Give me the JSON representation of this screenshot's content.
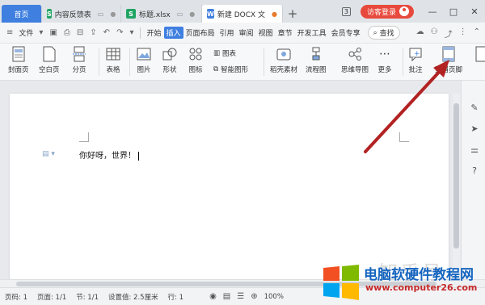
{
  "titlebar": {
    "home_tab": "首页",
    "tabs": [
      {
        "icon_letter": "S",
        "label": "内容反馈表"
      },
      {
        "icon_letter": "S",
        "label": "标题.xlsx"
      },
      {
        "icon_letter": "W",
        "label": "新建 DOCX 文"
      }
    ],
    "plus": "+",
    "badge": "3",
    "login_label": "访客登录",
    "window_buttons": [
      "—",
      "□",
      "✕"
    ]
  },
  "menu": {
    "file_label": "文件",
    "items": [
      "开始",
      "插入",
      "页面布局",
      "引用",
      "审阅",
      "视图",
      "章节",
      "开发工具",
      "会员专享"
    ],
    "active_item": "插入",
    "search_label": "查找"
  },
  "ribbon": {
    "cover_page": "封面页",
    "blank_page": "空白页",
    "page_break": "分页",
    "table": "表格",
    "picture": "图片",
    "shape": "形状",
    "icon": "图标",
    "chart": "图表",
    "smart_art": "智能图形",
    "docer_material": "稻壳素材",
    "flowchart": "流程图",
    "mind_map": "思维导图",
    "more": "更多",
    "comment": "批注",
    "header_footer": "页眉页脚"
  },
  "document": {
    "text": "你好呀，世界！"
  },
  "statusbar": {
    "page_num": "页码: 1",
    "page": "页面: 1/1",
    "section": "节: 1/1",
    "setting": "设置值: 2.5厘米",
    "row": "行: 1",
    "zoom": "100%"
  },
  "watermark": {
    "site_name": "电脑软硬件教程网",
    "site_url": "www.computer26.com",
    "faint_text": "知乎号"
  },
  "colors": {
    "accent": "#3f7fe0",
    "login": "#e8493d",
    "arrow": "#b22222",
    "brand_blue": "#1565c0",
    "brand_red": "#c62828"
  }
}
